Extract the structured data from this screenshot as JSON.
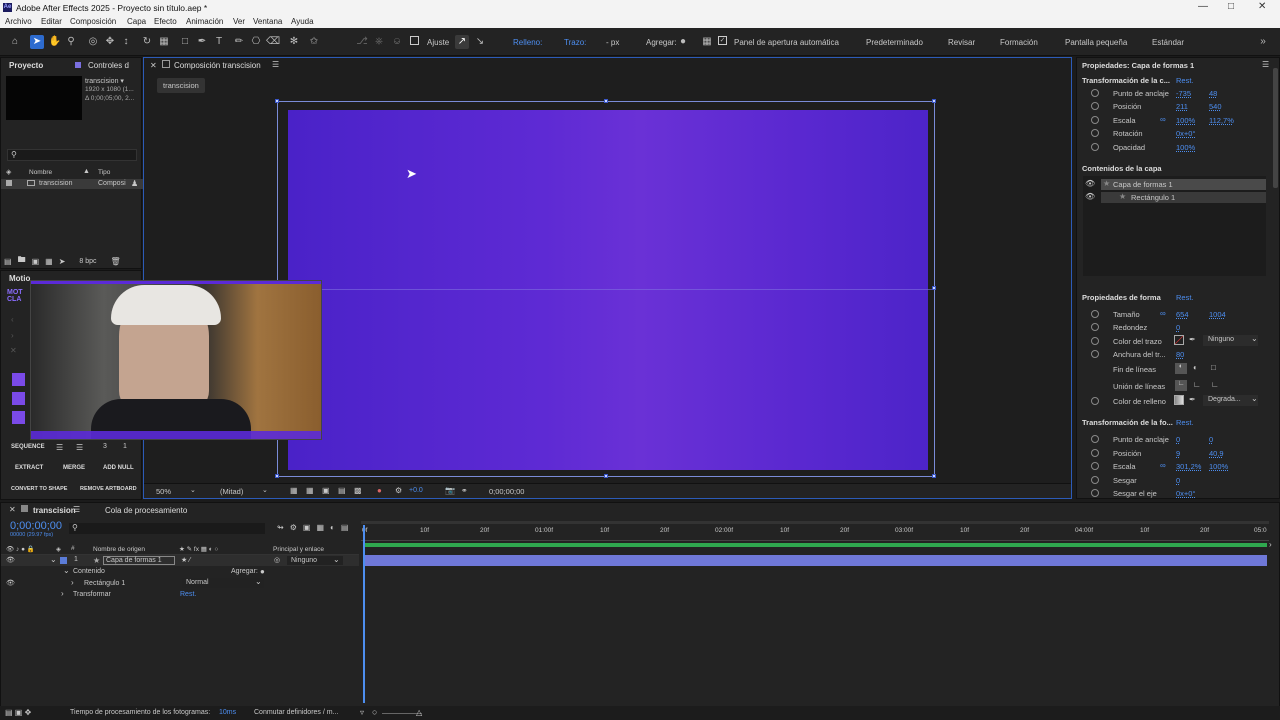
{
  "window": {
    "title": "Adobe After Effects 2025 - Proyecto sin título.aep *",
    "app_icon": "Ae"
  },
  "menu": [
    "Archivo",
    "Editar",
    "Composición",
    "Capa",
    "Efecto",
    "Animación",
    "Ver",
    "Ventana",
    "Ayuda"
  ],
  "toolbar": {
    "ajuste_label": "Ajuste",
    "relleno_label": "Relleno:",
    "trazo_label": "Trazo:",
    "px_label": "- px",
    "agregar_label": "Agregar:",
    "panel_label": "Panel de apertura automática",
    "workspaces": [
      "Predeterminado",
      "Revisar",
      "Formación",
      "Pantalla pequeña",
      "Estándar"
    ],
    "fill_color": "#5a2ad0",
    "stroke_color": "#7a1a1a"
  },
  "project": {
    "tab1": "Proyecto",
    "tab2": "Controles d",
    "item_name": "transcision ▾",
    "item_dims": "1920 x 1080 (1...",
    "item_dur": "Δ 0;00;05;00, 2...",
    "col_name": "Nombre",
    "col_type": "Tipo",
    "row_name": "transcision",
    "row_type": "Composi",
    "bpc": "8 bpc"
  },
  "motion": {
    "tab": "Motio",
    "logo": "MOT CLA",
    "buttons": [
      "SEQUENCE",
      "EXTRACT",
      "MERGE",
      "ADD NULL",
      "CONVERT TO SHAPE",
      "REMOVE ARTBOARD"
    ],
    "num1": "3",
    "num2": "1"
  },
  "comp": {
    "tab": "Composición transcision",
    "subtab": "transcision",
    "zoom": "50%",
    "quality": "(Mitad)",
    "exposure": "+0.0",
    "time": "0;00;00;00"
  },
  "props": {
    "title": "Propiedades: Capa de formas 1",
    "section1": "Transformación de la c...",
    "rest": "Rest.",
    "transform": [
      {
        "label": "Punto de anclaje",
        "v1": "-735",
        "v2": "48"
      },
      {
        "label": "Posición",
        "v1": "211",
        "v2": "540"
      },
      {
        "label": "Escala",
        "v1": "100%",
        "v2": "112,7%"
      },
      {
        "label": "Rotación",
        "v1": "0x+0°",
        "v2": ""
      },
      {
        "label": "Opacidad",
        "v1": "100%",
        "v2": ""
      }
    ],
    "contents_title": "Contenidos de la capa",
    "layer1": "Capa de formas 1",
    "layer2": "Rectángulo 1",
    "shape_title": "Propiedades de forma",
    "shape": [
      {
        "label": "Tamaño",
        "v1": "654",
        "v2": "1004"
      },
      {
        "label": "Redondez",
        "v1": "0",
        "v2": ""
      },
      {
        "label": "Color del trazo",
        "v1": "",
        "v2": ""
      },
      {
        "label": "Anchura del tr...",
        "v1": "80",
        "v2": ""
      },
      {
        "label": "Fin de líneas",
        "v1": "",
        "v2": ""
      },
      {
        "label": "Unión de líneas",
        "v1": "",
        "v2": ""
      },
      {
        "label": "Color de relleno",
        "v1": "",
        "v2": ""
      }
    ],
    "stroke_mode": "Ninguno",
    "fill_mode": "Degrada...",
    "xform_title": "Transformación de la fo...",
    "xform": [
      {
        "label": "Punto de anclaje",
        "v1": "0",
        "v2": "0"
      },
      {
        "label": "Posición",
        "v1": "9",
        "v2": "40,9"
      },
      {
        "label": "Escala",
        "v1": "301,2%",
        "v2": "100%"
      },
      {
        "label": "Sesgar",
        "v1": "0",
        "v2": ""
      },
      {
        "label": "Sesgar el eje",
        "v1": "0x+0°",
        "v2": ""
      }
    ]
  },
  "timeline": {
    "tab": "transcision",
    "tab2": "Cola de procesamiento",
    "timecode": "0;00;00;00",
    "frames": "00000 (29.97 fps)",
    "col_source": "Nombre de origen",
    "col_parent": "Principal y enlace",
    "layer_num": "1",
    "layer_name": "Capa de formas 1",
    "parent": "Ninguno",
    "contenido": "Contenido",
    "agregar": "Agregar:",
    "rect": "Rectángulo 1",
    "mode": "Normal",
    "transformar": "Transformar",
    "rest": "Rest.",
    "ticks": [
      "0f",
      "10f",
      "20f",
      "01:00f",
      "10f",
      "20f",
      "02:00f",
      "10f",
      "20f",
      "03:00f",
      "10f",
      "20f",
      "04:00f",
      "10f",
      "20f",
      "05:0"
    ]
  },
  "status": {
    "render_label": "Tiempo de procesamiento de los fotogramas:",
    "render_value": "10ms",
    "toggle": "Conmutar definidores / m..."
  }
}
